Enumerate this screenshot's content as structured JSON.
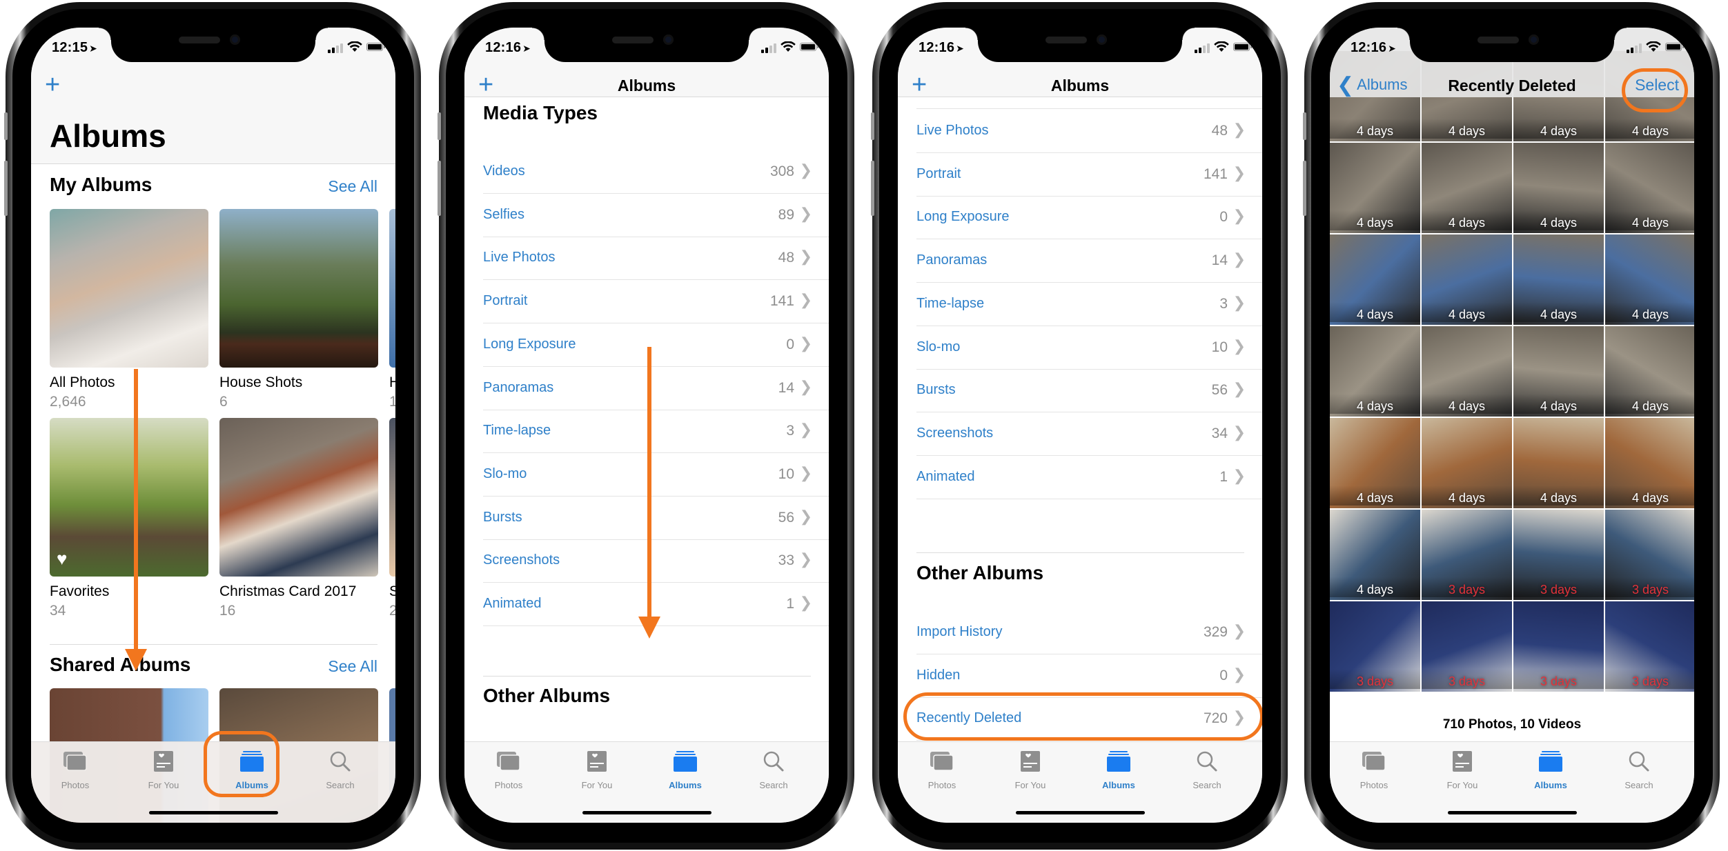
{
  "colors": {
    "accent": "#2f80c9",
    "annotation": "#f2761e",
    "secondary_text": "#8e8e8e",
    "deleted_warning": "#e2323a"
  },
  "tabbar": {
    "items": [
      {
        "label": "Photos",
        "icon": "photos-icon"
      },
      {
        "label": "For You",
        "icon": "for-you-icon"
      },
      {
        "label": "Albums",
        "icon": "albums-icon",
        "active": true
      },
      {
        "label": "Search",
        "icon": "search-icon"
      }
    ]
  },
  "phones": [
    {
      "time": "12:15",
      "add_icon": "+",
      "title": "Albums",
      "my_albums": {
        "title": "My Albums",
        "see_all": "See All",
        "albums": [
          {
            "name": "All Photos",
            "count": "2,646"
          },
          {
            "name": "House Shots",
            "count": "6"
          },
          {
            "name": "H",
            "count": "1"
          },
          {
            "name": "Favorites",
            "count": "34"
          },
          {
            "name": "Christmas Card 2017",
            "count": "16"
          },
          {
            "name": "S",
            "count": "2"
          }
        ]
      },
      "shared_albums": {
        "title": "Shared Albums",
        "see_all": "See All"
      }
    },
    {
      "time": "12:16",
      "add_icon": "+",
      "title": "Albums",
      "media_types_title": "Media Types",
      "rows": [
        {
          "label": "Videos",
          "count": "308"
        },
        {
          "label": "Selfies",
          "count": "89"
        },
        {
          "label": "Live Photos",
          "count": "48"
        },
        {
          "label": "Portrait",
          "count": "141"
        },
        {
          "label": "Long Exposure",
          "count": "0"
        },
        {
          "label": "Panoramas",
          "count": "14"
        },
        {
          "label": "Time-lapse",
          "count": "3"
        },
        {
          "label": "Slo-mo",
          "count": "10"
        },
        {
          "label": "Bursts",
          "count": "56"
        },
        {
          "label": "Screenshots",
          "count": "33"
        },
        {
          "label": "Animated",
          "count": "1"
        }
      ],
      "other_albums_title": "Other Albums"
    },
    {
      "time": "12:16",
      "add_icon": "+",
      "title": "Albums",
      "rows": [
        {
          "label": "Live Photos",
          "count": "48"
        },
        {
          "label": "Portrait",
          "count": "141"
        },
        {
          "label": "Long Exposure",
          "count": "0"
        },
        {
          "label": "Panoramas",
          "count": "14"
        },
        {
          "label": "Time-lapse",
          "count": "3"
        },
        {
          "label": "Slo-mo",
          "count": "10"
        },
        {
          "label": "Bursts",
          "count": "56"
        },
        {
          "label": "Screenshots",
          "count": "34"
        },
        {
          "label": "Animated",
          "count": "1"
        }
      ],
      "other_albums_title": "Other Albums",
      "other_rows": [
        {
          "label": "Import History",
          "count": "329"
        },
        {
          "label": "Hidden",
          "count": "0"
        },
        {
          "label": "Recently Deleted",
          "count": "720"
        }
      ]
    },
    {
      "time": "12:16",
      "back_label": "Albums",
      "title": "Recently Deleted",
      "select_label": "Select",
      "grid": [
        [
          "4 days",
          "4 days",
          "4 days",
          "4 days"
        ],
        [
          "4 days",
          "4 days",
          "4 days",
          "4 days"
        ],
        [
          "4 days",
          "4 days",
          "4 days",
          "4 days"
        ],
        [
          "4 days",
          "4 days",
          "4 days",
          "4 days"
        ],
        [
          "4 days",
          "4 days",
          "4 days",
          "4 days"
        ],
        [
          "4 days",
          "3 days",
          "3 days",
          "3 days"
        ],
        [
          "3 days",
          "3 days",
          "3 days",
          "3 days"
        ]
      ],
      "footer": "710 Photos, 10 Videos"
    }
  ]
}
